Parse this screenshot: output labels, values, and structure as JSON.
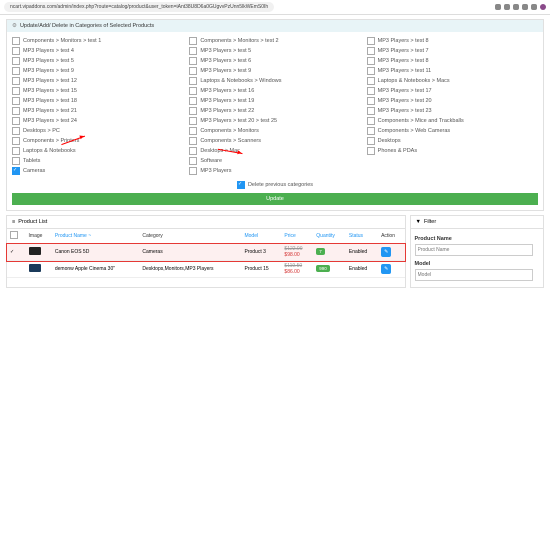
{
  "url": "ncart.vipaddons.com/admin/index.php?route=catalog/product&user_token=iAnt38U8D6a0GUgvvPzUnn5lkWEmS0Ih",
  "panel": {
    "title": "Update/Add/ Delete in Categories of Selected Products"
  },
  "cols": {
    "c1": [
      "Components  >  Monitors  >  test 1",
      "MP3 Players  >  test 4",
      "MP3 Players  >  test 5",
      "MP3 Players  >  test 9",
      "MP3 Players  >  test 12",
      "MP3 Players  >  test 15",
      "MP3 Players  >  test 18",
      "MP3 Players  >  test 21",
      "MP3 Players  >  test 24",
      "Desktops  >  PC",
      "Components  >  Printers",
      "Laptops & Notebooks",
      "Tablets",
      "Cameras"
    ],
    "c2": [
      "Components  >  Monitors  >  test 2",
      "MP3 Players  >  test 5",
      "MP3 Players  >  test 6",
      "MP3 Players  >  test 9",
      "Laptops & Notebooks  >  Windows",
      "MP3 Players  >  test 16",
      "MP3 Players  >  test 19",
      "MP3 Players  >  test 22",
      "MP3 Players  >  test 20  >  test 25",
      "Components  >  Monitors",
      "Components  >  Scanners",
      "Desktops  >  Mac",
      "Software",
      "MP3 Players"
    ],
    "c3": [
      "MP3 Players  >  test 8",
      "MP3 Players  >  test 7",
      "MP3 Players  >  test 8",
      "MP3 Players  >  test 11",
      "Laptops & Notebooks  >  Macs",
      "MP3 Players  >  test 17",
      "MP3 Players  >  test 20",
      "MP3 Players  >  test 23",
      "Components  >  Mice and Trackballs",
      "Components  >  Web Cameras",
      "Desktops",
      "Phones & PDAs"
    ]
  },
  "checked": {
    "c1_13": true
  },
  "delete_prev": "Delete previous categories",
  "update_btn": "Update",
  "plist": {
    "title": "Product List",
    "headers": {
      "img": "Image",
      "name": "Product Name ~",
      "cat": "Category",
      "model": "Model",
      "price": "Price",
      "qty": "Quantity",
      "status": "Status",
      "action": "Action"
    },
    "rows": [
      {
        "sel": true,
        "name": "Canon EOS 5D",
        "cat": "Cameras",
        "model": "Product 3",
        "price_strike": "$122.00",
        "price": "$98.00",
        "qty": "7",
        "status": "Enabled"
      },
      {
        "sel": false,
        "name": "demonw Apple Cinema 30\"",
        "cat": "Desktops,Monitors,MP3 Players",
        "model": "Product 15",
        "price_strike": "$119.50",
        "price": "$86.00",
        "qty": "990",
        "status": "Enabled"
      }
    ]
  },
  "filter": {
    "title": "Filter",
    "pn_label": "Product Name",
    "pn_ph": "Product Name",
    "model_label": "Model",
    "model_ph": "Model"
  }
}
